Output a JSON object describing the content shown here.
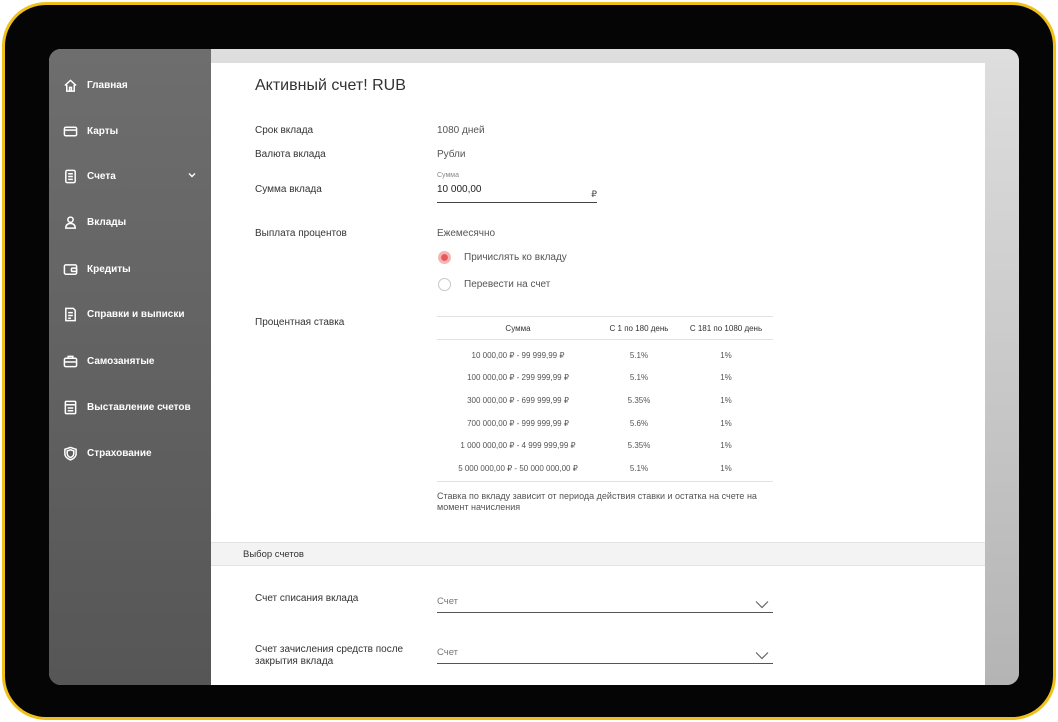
{
  "sidebar": {
    "items": [
      {
        "label": "Главная",
        "icon": "home-icon"
      },
      {
        "label": "Карты",
        "icon": "card-icon"
      },
      {
        "label": "Счета",
        "icon": "document-icon"
      },
      {
        "label": "Вклады",
        "icon": "user-icon"
      },
      {
        "label": "Кредиты",
        "icon": "wallet-icon"
      },
      {
        "label": "Справки и выписки",
        "icon": "receipt-icon"
      },
      {
        "label": "Самозанятые",
        "icon": "briefcase-icon"
      },
      {
        "label": "Выставление счетов",
        "icon": "invoice-icon"
      },
      {
        "label": "Страхование",
        "icon": "shield-icon"
      }
    ]
  },
  "deposit": {
    "title": "Активный счет! RUB",
    "term_label": "Срок вклада",
    "term_value": "1080 дней",
    "currency_label": "Валюта вклада",
    "currency_value": "Рубли",
    "amount_label": "Сумма вклада",
    "amount_caption": "Сумма",
    "amount_value": "10 000,00",
    "amount_currency": "₽",
    "payout_label": "Выплата процентов",
    "payout_value": "Ежемесячно",
    "payout_options": [
      {
        "label": "Причислять ко вкладу",
        "selected": true
      },
      {
        "label": "Перевести на счет",
        "selected": false
      }
    ],
    "rate_label": "Процентная ставка",
    "rate_table": {
      "headers": [
        "Сумма",
        "С 1 по 180 день",
        "С 181 по 1080 день"
      ],
      "rows": [
        [
          "10 000,00 ₽ - 99 999,99 ₽",
          "5.1%",
          "1%"
        ],
        [
          "100 000,00 ₽ - 299 999,99 ₽",
          "5.1%",
          "1%"
        ],
        [
          "300 000,00 ₽ - 699 999,99 ₽",
          "5.35%",
          "1%"
        ],
        [
          "700 000,00 ₽ - 999 999,99 ₽",
          "5.6%",
          "1%"
        ],
        [
          "1 000 000,00 ₽ - 4 999 999,99 ₽",
          "5.35%",
          "1%"
        ],
        [
          "5 000 000,00 ₽ - 50 000 000,00 ₽",
          "5.1%",
          "1%"
        ]
      ]
    },
    "rate_note": "Ставка по вкладу зависит от периода действия ставки и остатка на счете на момент начисления"
  },
  "accounts": {
    "section_title": "Выбор счетов",
    "debit_label": "Счет списания вклада",
    "debit_placeholder": "Счет",
    "credit_label": "Счет зачисления средств после закрытия вклада",
    "credit_placeholder": "Счет"
  },
  "colors": {
    "frame": "#f0c01a",
    "radio_active": "#e85a5a",
    "sidebar": "#666666"
  }
}
